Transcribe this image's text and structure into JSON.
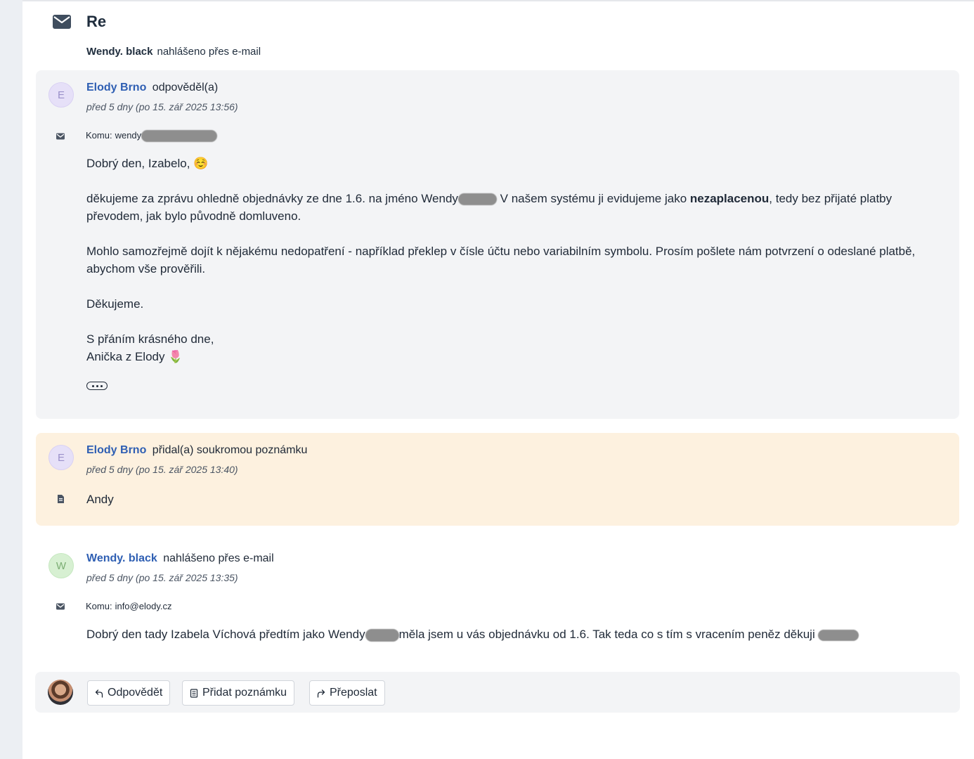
{
  "ticket": {
    "title": "Re",
    "reporter_name": "Wendy. black",
    "reporter_action": "nahlášeno přes e-mail"
  },
  "messages": [
    {
      "avatar_letter": "E",
      "author": "Elody Brno",
      "action": "odpověděl(a)",
      "timestamp": "před 5 dny (po 15. zář 2025 13:56)",
      "to_label": "Komu:",
      "to_value": "wendy",
      "greeting": "Dobrý den, Izabelo, ☺️",
      "para1_a": "děkujeme za zprávu ohledně objednávky ze dne 1.6. na jméno Wendy",
      "para1_b": " V našem systému ji evidujeme jako ",
      "para1_bold": "nezaplacenou",
      "para1_c": ", tedy bez přijaté platby převodem, jak bylo původně domluveno.",
      "para2": "Mohlo samozřejmě dojít k nějakému nedopatření - například překlep v čísle účtu nebo variabilním symbolu. Prosím pošlete nám potvrzení o odeslané platbě, abychom vše prověřili.",
      "para3": "Děkujeme.",
      "sign1": "S přáním krásného dne,",
      "sign2": "Anička z Elody 🌷"
    },
    {
      "avatar_letter": "E",
      "author": "Elody Brno",
      "action": "přidal(a) soukromou poznámku",
      "timestamp": "před 5 dny (po 15. zář 2025 13:40)",
      "note": "Andy"
    },
    {
      "avatar_letter": "W",
      "author": "Wendy. black",
      "action": "nahlášeno přes e-mail",
      "timestamp": "před 5 dny (po 15. zář 2025 13:35)",
      "to_label": "Komu:",
      "to_value": "info@elody.cz",
      "body_a": "Dobrý den tady Izabela Víchová předtím jako Wendy",
      "body_b": "měla jsem u vás objednávku od 1.6. Tak teda co s tím s vracením peněz děkuji "
    }
  ],
  "actions": {
    "reply_label": "Odpovědět",
    "note_label": "Přidat poznámku",
    "forward_label": "Přeposlat"
  },
  "icons": {
    "header": "envelope-icon",
    "email": "envelope-icon",
    "note": "document-icon",
    "reply": "reply-arrow-icon",
    "forward": "forward-arrow-icon"
  },
  "colors": {
    "link": "#2f5fb3",
    "note_bg": "#fdf1df",
    "message_bg": "#f3f4f6"
  }
}
